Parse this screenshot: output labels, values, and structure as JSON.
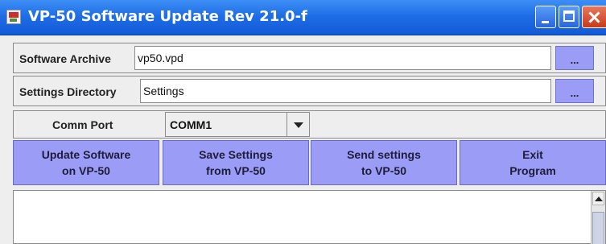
{
  "window": {
    "title": "VP-50 Software Update Rev 21.0-f"
  },
  "archive": {
    "label": "Software Archive",
    "value": "vp50.vpd",
    "browse_label": "..."
  },
  "settings_dir": {
    "label": "Settings Directory",
    "value": "Settings",
    "browse_label": "..."
  },
  "comm": {
    "label": "Comm Port",
    "selected": "COMM1"
  },
  "actions": [
    {
      "line1": "Update Software",
      "line2": "on VP-50"
    },
    {
      "line1": "Save Settings",
      "line2": "from VP-50"
    },
    {
      "line1": "Send settings",
      "line2": "to VP-50"
    },
    {
      "line1": "Exit",
      "line2": "Program"
    }
  ],
  "output": {
    "text": ""
  },
  "icons": {
    "app": "java-app-icon",
    "minimize": "minimize-icon",
    "maximize": "maximize-icon",
    "close": "close-icon",
    "dropdown": "chevron-down-icon",
    "scroll_up": "arrow-up-icon"
  },
  "colors": {
    "titlebar": "#1f6ee6",
    "button": "#9b9cf6",
    "background": "#eeeeee",
    "close": "#c93a1a"
  }
}
